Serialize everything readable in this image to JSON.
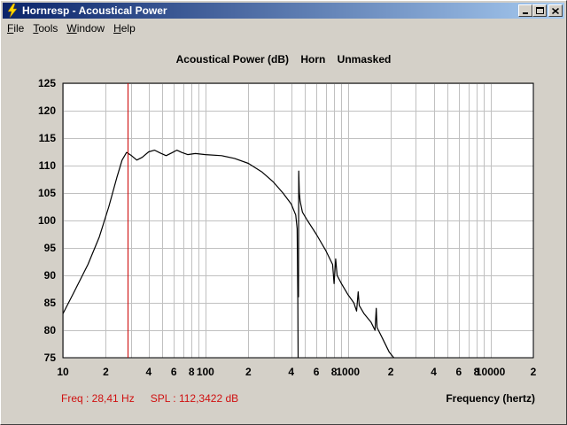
{
  "window": {
    "title": "Hornresp - Acoustical Power",
    "minimize_icon": "minimize-icon",
    "maximize_icon": "maximize-icon",
    "close_icon": "close-icon"
  },
  "menu": {
    "items": [
      {
        "label": "File",
        "accel": "F",
        "rest": "ile"
      },
      {
        "label": "Tools",
        "accel": "T",
        "rest": "ools"
      },
      {
        "label": "Window",
        "accel": "W",
        "rest": "indow"
      },
      {
        "label": "Help",
        "accel": "H",
        "rest": "elp"
      }
    ]
  },
  "chart_title": "Acoustical Power (dB)    Horn    Unmasked",
  "status": {
    "freq": "Freq : 28,41 Hz",
    "spl": "SPL : 112,3422 dB"
  },
  "colors": {
    "curve": "#000000",
    "marker": "#cc0000",
    "grid": "#c0c0c0",
    "plot_bg": "#ffffff"
  },
  "chart_data": {
    "type": "line",
    "title": "Acoustical Power (dB)    Horn    Unmasked",
    "xlabel": "Frequency (hertz)",
    "ylabel": "",
    "x_scale": "log",
    "xlim": [
      10,
      20000
    ],
    "ylim": [
      75,
      125
    ],
    "grid": true,
    "y_ticks": [
      125,
      120,
      115,
      110,
      105,
      100,
      95,
      90,
      85,
      80,
      75
    ],
    "x_tick_labels": [
      {
        "x": 10,
        "label": "10"
      },
      {
        "x": 20,
        "label": "2"
      },
      {
        "x": 40,
        "label": "4"
      },
      {
        "x": 60,
        "label": "6"
      },
      {
        "x": 80,
        "label": "8"
      },
      {
        "x": 100,
        "label": "100"
      },
      {
        "x": 200,
        "label": "2"
      },
      {
        "x": 400,
        "label": "4"
      },
      {
        "x": 600,
        "label": "6"
      },
      {
        "x": 800,
        "label": "8"
      },
      {
        "x": 1000,
        "label": "1000"
      },
      {
        "x": 2000,
        "label": "2"
      },
      {
        "x": 4000,
        "label": "4"
      },
      {
        "x": 6000,
        "label": "6"
      },
      {
        "x": 8000,
        "label": "8"
      },
      {
        "x": 10000,
        "label": "10000"
      },
      {
        "x": 20000,
        "label": "2"
      }
    ],
    "marker_x": 28.41,
    "series": [
      {
        "points": [
          [
            10,
            83
          ],
          [
            12,
            87
          ],
          [
            15,
            92
          ],
          [
            18,
            97
          ],
          [
            21,
            102.5
          ],
          [
            24,
            108
          ],
          [
            26,
            111
          ],
          [
            28,
            112.4
          ],
          [
            30,
            111.9
          ],
          [
            33,
            111
          ],
          [
            36,
            111.5
          ],
          [
            40,
            112.5
          ],
          [
            44,
            112.8
          ],
          [
            48,
            112.3
          ],
          [
            53,
            111.8
          ],
          [
            58,
            112.3
          ],
          [
            63,
            112.8
          ],
          [
            68,
            112.4
          ],
          [
            75,
            112
          ],
          [
            85,
            112.2
          ],
          [
            100,
            112
          ],
          [
            130,
            111.8
          ],
          [
            160,
            111.3
          ],
          [
            200,
            110.4
          ],
          [
            250,
            108.8
          ],
          [
            300,
            107
          ],
          [
            350,
            105
          ],
          [
            400,
            103
          ],
          [
            430,
            101
          ],
          [
            440,
            98.5
          ],
          [
            445,
            85
          ],
          [
            447,
            75
          ]
        ]
      },
      {
        "points": [
          [
            450,
            86
          ],
          [
            452,
            109
          ],
          [
            456,
            105
          ],
          [
            462,
            103.5
          ],
          [
            480,
            101.5
          ],
          [
            520,
            100
          ],
          [
            600,
            97.5
          ],
          [
            700,
            94.5
          ],
          [
            780,
            92
          ],
          [
            800,
            88.5
          ],
          [
            820,
            93
          ],
          [
            840,
            90
          ],
          [
            900,
            88.5
          ],
          [
            1000,
            86.5
          ],
          [
            1100,
            85
          ],
          [
            1150,
            83.5
          ],
          [
            1180,
            87
          ],
          [
            1200,
            84.5
          ],
          [
            1300,
            83
          ],
          [
            1450,
            81.5
          ],
          [
            1550,
            80
          ],
          [
            1580,
            84
          ],
          [
            1600,
            80.5
          ],
          [
            1750,
            78.5
          ],
          [
            1950,
            76
          ],
          [
            2100,
            75
          ]
        ]
      }
    ]
  }
}
